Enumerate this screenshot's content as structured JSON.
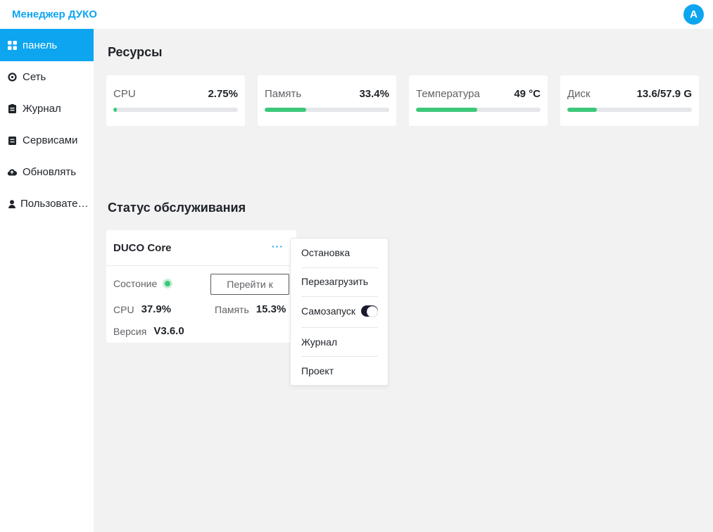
{
  "header": {
    "title": "Менеджер ДУКО",
    "avatar_letter": "A"
  },
  "sidebar": {
    "items": [
      {
        "label": "панель",
        "icon": "dashboard-icon",
        "active": true
      },
      {
        "label": "Сеть",
        "icon": "network-icon"
      },
      {
        "label": "Журнал",
        "icon": "log-icon"
      },
      {
        "label": "Сервисами",
        "icon": "services-icon"
      },
      {
        "label": "Обновлять",
        "icon": "cloud-icon"
      },
      {
        "label": "Пользоватe…",
        "icon": "user-icon"
      }
    ]
  },
  "resources": {
    "title": "Ресурсы",
    "cards": [
      {
        "name": "CPU",
        "value": "2.75%",
        "fill_percent": 2.75
      },
      {
        "name": "Память",
        "value": "33.4%",
        "fill_percent": 33.4
      },
      {
        "name": "Температура",
        "value": "49 °C",
        "fill_percent": 49
      },
      {
        "name": "Диск",
        "value": "13.6/57.9 G",
        "fill_percent": 23.5
      }
    ]
  },
  "service_status": {
    "title": "Статус обслуживания",
    "service": {
      "name": "DUCO Core",
      "more_label": "···",
      "state_label": "Состоние",
      "goto_label": "Перейти к",
      "cpu_label": "CPU",
      "cpu_value": "37.9%",
      "memory_label": "Память",
      "memory_value": "15.3%",
      "version_label": "Версия",
      "version_value": "V3.6.0"
    }
  },
  "menu": {
    "stop": "Остановка",
    "restart": "Перезагрузить",
    "autostart": "Самозапуск",
    "autostart_on": true,
    "log": "Журнал",
    "project": "Проект"
  },
  "colors": {
    "accent": "#0ea5f0",
    "progress": "#3cc87a",
    "track": "#e4e6ea"
  }
}
